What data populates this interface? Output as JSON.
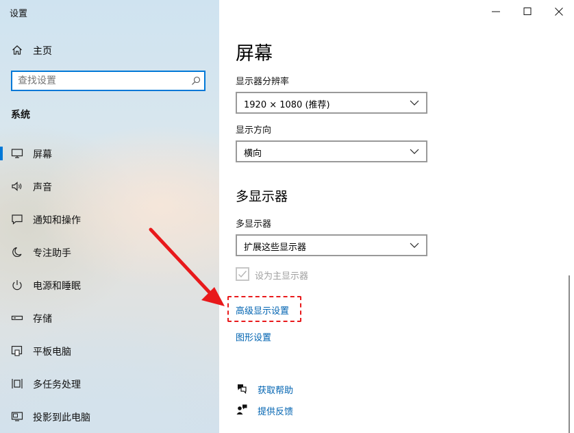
{
  "app": {
    "title": "设置"
  },
  "sidebar": {
    "home_label": "主页",
    "search_placeholder": "查找设置",
    "section": "系统",
    "items": [
      {
        "label": "屏幕",
        "icon": "monitor-icon",
        "active": true
      },
      {
        "label": "声音",
        "icon": "speaker-icon"
      },
      {
        "label": "通知和操作",
        "icon": "notification-icon"
      },
      {
        "label": "专注助手",
        "icon": "moon-icon"
      },
      {
        "label": "电源和睡眠",
        "icon": "power-icon"
      },
      {
        "label": "存储",
        "icon": "storage-icon"
      },
      {
        "label": "平板电脑",
        "icon": "tablet-icon"
      },
      {
        "label": "多任务处理",
        "icon": "multitask-icon"
      },
      {
        "label": "投影到此电脑",
        "icon": "project-icon"
      }
    ]
  },
  "main": {
    "title": "屏幕",
    "resolution_label": "显示器分辨率",
    "resolution_value": "1920 × 1080 (推荐)",
    "orientation_label": "显示方向",
    "orientation_value": "横向",
    "multi_title": "多显示器",
    "multi_label": "多显示器",
    "multi_value": "扩展这些显示器",
    "primary_checkbox": {
      "label": "设为主显示器",
      "checked": true,
      "enabled": false
    },
    "advanced_link": "高级显示设置",
    "graphics_link": "图形设置",
    "help_link": "获取帮助",
    "feedback_link": "提供反馈"
  },
  "colors": {
    "accent": "#0078d7",
    "link": "#0063b1",
    "annotation": "#e8191b"
  }
}
